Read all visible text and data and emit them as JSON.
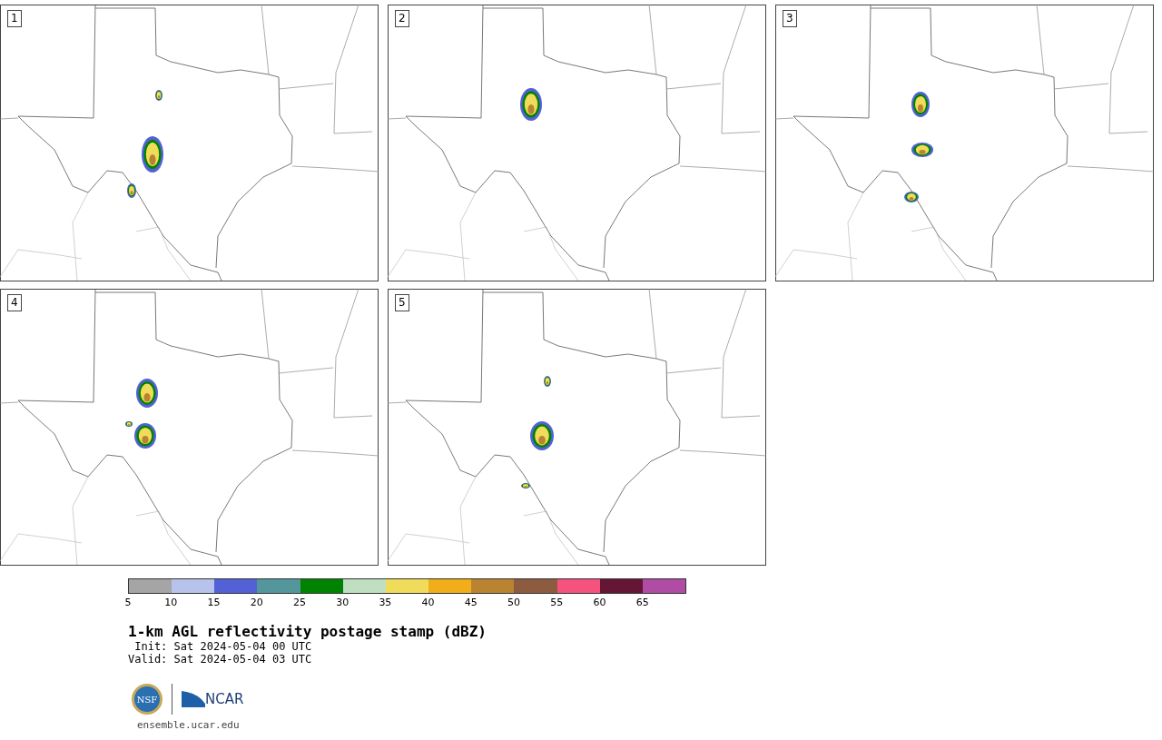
{
  "panels": [
    {
      "label": "1"
    },
    {
      "label": "2"
    },
    {
      "label": "3"
    },
    {
      "label": "4"
    },
    {
      "label": "5"
    }
  ],
  "colorbar": {
    "segments": [
      {
        "color": "#a5a5a5"
      },
      {
        "color": "#b8c3ec"
      },
      {
        "color": "#5361d6"
      },
      {
        "color": "#53969c"
      },
      {
        "color": "#008300"
      },
      {
        "color": "#c0dfc0"
      },
      {
        "color": "#f0dc5a"
      },
      {
        "color": "#f1ae19"
      },
      {
        "color": "#ba8330"
      },
      {
        "color": "#8c5b40"
      },
      {
        "color": "#f5527e"
      },
      {
        "color": "#641634"
      },
      {
        "color": "#b14ca5"
      }
    ],
    "ticks": [
      "5",
      "10",
      "15",
      "20",
      "25",
      "30",
      "35",
      "40",
      "45",
      "50",
      "55",
      "60",
      "65"
    ]
  },
  "title": "1-km AGL reflectivity postage stamp (dBZ)",
  "init": " Init: Sat 2024-05-04 00 UTC",
  "valid": "Valid: Sat 2024-05-04 03 UTC",
  "logos": {
    "nsf": "NSF",
    "ncar": "NCAR"
  },
  "footer": "ensemble.ucar.edu"
}
